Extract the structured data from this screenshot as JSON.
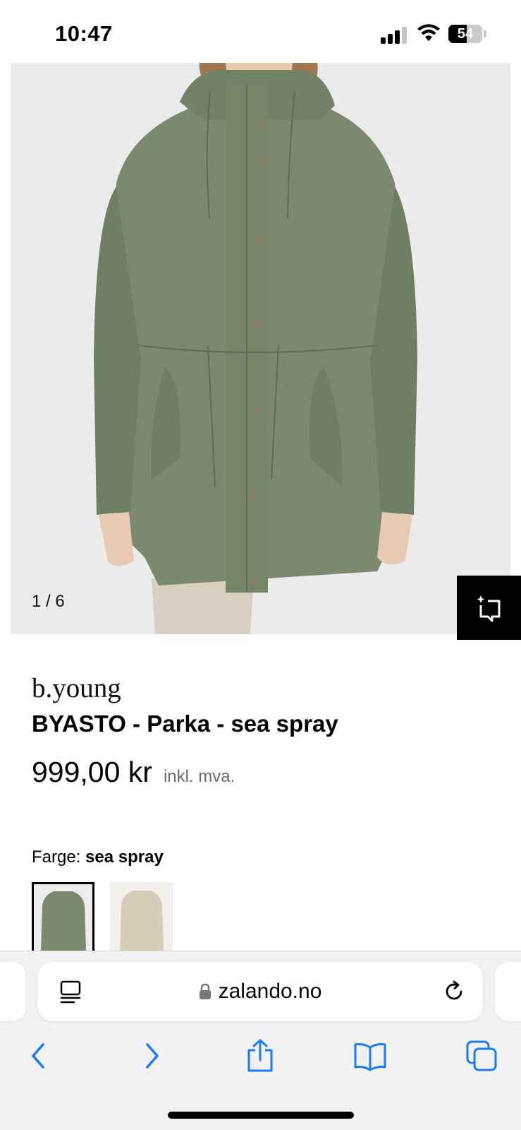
{
  "status_bar": {
    "time": "10:47",
    "battery_level": "54",
    "battery_fraction": 0.54,
    "signal_bars_active": 3,
    "icons": [
      "signal-icon",
      "wifi-icon",
      "battery-icon"
    ]
  },
  "gallery": {
    "counter": "1 / 6",
    "current_image": 1,
    "total_images": 6,
    "visual_search_icon": "visual-search-icon"
  },
  "product": {
    "brand": "b.young",
    "title": "BYASTO - Parka - sea spray",
    "price": "999,00 kr",
    "tax_note": "inkl. mva."
  },
  "color": {
    "label": "Farge:",
    "selected": "sea spray",
    "swatches": [
      {
        "name": "sea spray",
        "color": "#7b8a6e",
        "selected": true
      },
      {
        "name": "beige",
        "color": "#d6cdb9",
        "selected": false
      }
    ]
  },
  "browser": {
    "url": "zalando.no",
    "icons": [
      "reader-icon",
      "lock-icon",
      "reload-icon",
      "back-icon",
      "forward-icon",
      "share-icon",
      "bookmarks-icon",
      "tabs-icon"
    ],
    "accent_color": "#1a7cf5"
  },
  "colors": {
    "image_background": "#ebebeb",
    "coat_green": "#7b8a6e",
    "text": "#000000",
    "muted_text": "#6b6b6b"
  }
}
